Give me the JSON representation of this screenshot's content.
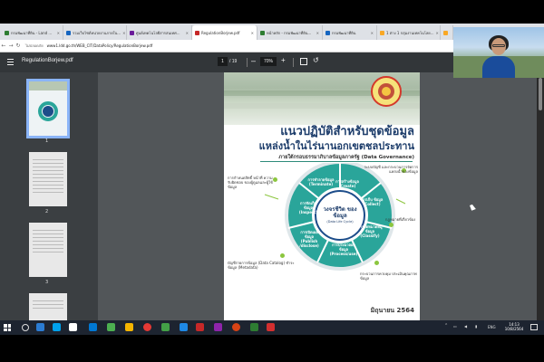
{
  "browser": {
    "tabs": [
      {
        "label": "กรมพัฒนาที่ดิน - Land ...",
        "color": "#2e7d32"
      },
      {
        "label": "รวมเว็บไซต์หน่วยงานภายใน...",
        "color": "#1565c0"
      },
      {
        "label": "ศูนย์เทคโนโลยีสารสนเทศ...",
        "color": "#6a1b9a"
      },
      {
        "label": "RegulationBorjew.pdf",
        "color": "#c62828"
      },
      {
        "label": "หน้าหลัก - กรมพัฒนาที่ดิน...",
        "color": "#2e7d32"
      },
      {
        "label": "กรมพัฒนาที่ดิน",
        "color": "#1565c0"
      },
      {
        "label": "1 ต่าง 1 กลุ่มงานเทคโนโลย...",
        "color": "#f9a825"
      },
      {
        "label": "1 ต่าง 1 กลุ่มงานเทคโนโลย...",
        "color": "#f9a825"
      }
    ],
    "security_label": "ไม่ปลอดภัย",
    "url": "www1.ldd.go.th/WEB_CIT/DataPolicy/RegulationBorjew.pdf"
  },
  "pdf": {
    "filename": "RegulationBorjew.pdf",
    "page_current": "1",
    "page_total": "/ 19",
    "zoom": "70%",
    "thumbnails": [
      "1",
      "2",
      "3"
    ]
  },
  "document": {
    "title_line1": "แนวปฏิบัติสำหรับชุดข้อมูล",
    "title_line2": "แหล่งน้ำในไร่นานอกเขตชลประทาน",
    "subtitle": "ภายใต้กรอบธรรมาภิบาลข้อมูลภาครัฐ (Data Governance)",
    "center_title": "วงจรชีวิต ของข้อมูล",
    "center_sub": "(Data Life Cycle)",
    "segments": [
      "การสร้างข้อมูล (Create)",
      "การเก็บ ข้อมูล (Collect)",
      "การจัดหมวดหมู่ข้อมูล (Classify)",
      "การประมวลผลข้อมูล (Process/use)",
      "การเปิดเผยข้อมูล (Publish /disclose)",
      "การจัดเก็บ ข้อมูล (Inspect)",
      "การทำลายข้อมูล (Terminate)"
    ],
    "side_notes": [
      "ระบบบัญชี และกระบวนการจัดการ แหล่งน้ำของข้อมูล",
      "การกำหนดสิทธิ์ หน้าที่ ความรับผิดชอบ ของผู้ดูแลและผู้ใช้ข้อมูล",
      "กฎหมายที่เกี่ยวข้อง",
      "บัญชีรายการข้อมูล (Data Catalog) ชำระข้อมูล (Metadata)",
      "กระบวนการควบคุม ประเมินคุณภาพข้อมูล"
    ],
    "footer": "มิถุนายน  2564"
  },
  "taskbar": {
    "lang": "ENG",
    "time": "14:13",
    "date": "10/8/2564"
  },
  "colors": {
    "ring_teal": "#2aa59a",
    "ring_blue": "#1d4d8a",
    "accent_green": "#8cc63f"
  }
}
